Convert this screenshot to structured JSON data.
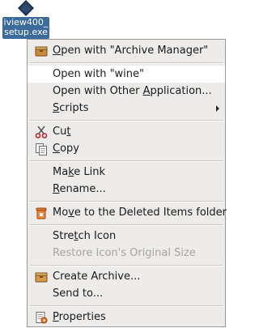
{
  "desktop_file": {
    "name_line1": "iview400_",
    "name_line2": "setup.exe",
    "icon": "diamond-file-icon"
  },
  "context_menu": {
    "items": [
      {
        "pre": "",
        "key": "O",
        "post": "pen with \"Archive Manager\"",
        "icon": "archive-manager-icon"
      },
      {
        "pre": "Open with \"wine\"",
        "key": "",
        "post": "",
        "highlighted": true
      },
      {
        "pre": "Open with Other ",
        "key": "A",
        "post": "pplication..."
      },
      {
        "pre": "",
        "key": "S",
        "post": "cripts",
        "submenu": true
      },
      {
        "pre": "Cu",
        "key": "t",
        "post": "",
        "icon": "scissors-icon"
      },
      {
        "pre": "",
        "key": "C",
        "post": "opy",
        "icon": "copy-icon"
      },
      {
        "pre": "Ma",
        "key": "k",
        "post": "e Link"
      },
      {
        "pre": "",
        "key": "R",
        "post": "ename..."
      },
      {
        "pre": "Mo",
        "key": "v",
        "post": "e to the Deleted Items folder",
        "icon": "trash-icon"
      },
      {
        "pre": "Stre",
        "key": "t",
        "post": "ch Icon"
      },
      {
        "pre": "Restore Icon's Original Size",
        "key": "",
        "post": "",
        "disabled": true
      },
      {
        "pre": "Create Archive...",
        "key": "",
        "post": "",
        "icon": "create-archive-icon"
      },
      {
        "pre": "Send to...",
        "key": "",
        "post": ""
      },
      {
        "pre": "",
        "key": "P",
        "post": "roperties",
        "icon": "properties-icon"
      }
    ]
  }
}
